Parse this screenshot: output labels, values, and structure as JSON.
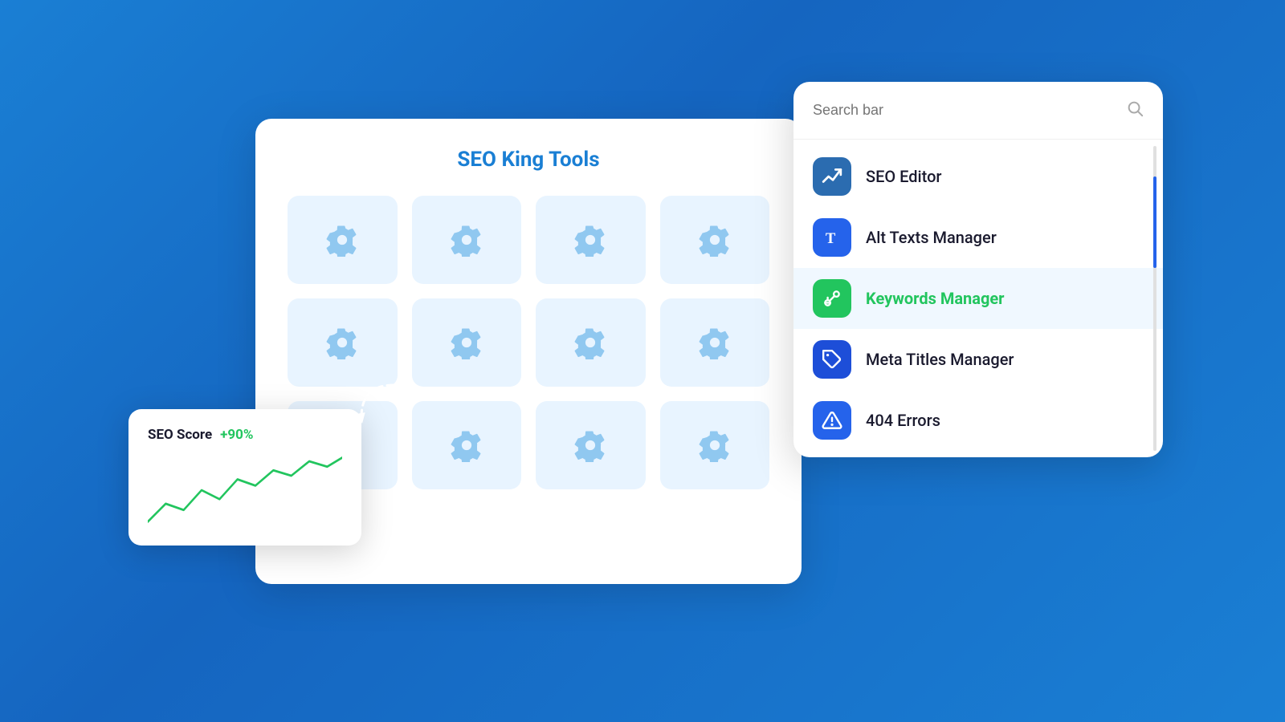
{
  "background": {
    "color": "#1a7fd4"
  },
  "seo_score_card": {
    "label": "SEO Score",
    "value": "+90%",
    "chart": {
      "line_color": "#22c55e",
      "points": [
        0,
        30,
        20,
        45,
        35,
        55,
        50,
        70,
        65,
        85,
        80,
        95
      ]
    }
  },
  "main_panel": {
    "title": "SEO King Tools",
    "grid_count": 12
  },
  "search_panel": {
    "search_placeholder": "Search bar",
    "menu_items": [
      {
        "id": "seo-editor",
        "label": "SEO Editor",
        "icon": "chart-up",
        "icon_color": "blue",
        "active": false
      },
      {
        "id": "alt-texts-manager",
        "label": "Alt Texts Manager",
        "icon": "T",
        "icon_color": "blue2",
        "active": false
      },
      {
        "id": "keywords-manager",
        "label": "Keywords Manager",
        "icon": "key",
        "icon_color": "green",
        "active": true
      },
      {
        "id": "meta-titles-manager",
        "label": "Meta Titles Manager",
        "icon": "tag",
        "icon_color": "blue3",
        "active": false
      },
      {
        "id": "404-errors",
        "label": "404 Errors",
        "icon": "warning",
        "icon_color": "yellow",
        "active": false
      }
    ]
  }
}
